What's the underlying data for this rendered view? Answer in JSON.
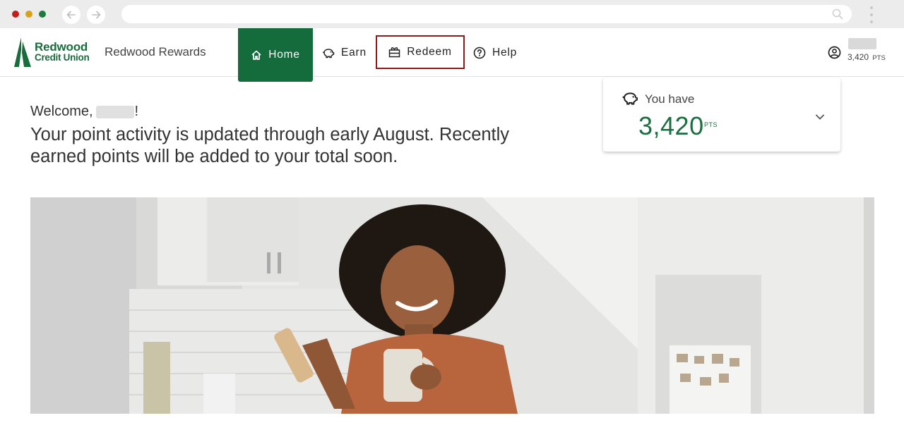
{
  "browser": {
    "back_icon": "arrow-left-icon",
    "forward_icon": "arrow-right-icon",
    "search_icon": "search-icon",
    "menu_icon": "kebab-menu-icon"
  },
  "brand": {
    "logo_line1": "Redwood",
    "logo_line2": "Credit Union",
    "program_name": "Redwood Rewards",
    "color": "#146b3c"
  },
  "nav": {
    "items": [
      {
        "label": "Home",
        "icon": "home-icon",
        "active": true
      },
      {
        "label": "Earn",
        "icon": "piggy-bank-icon"
      },
      {
        "label": "Redeem",
        "icon": "gift-icon",
        "highlighted": true
      },
      {
        "label": "Help",
        "icon": "help-circle-icon"
      }
    ]
  },
  "account": {
    "icon": "user-circle-icon",
    "points": "3,420",
    "points_unit": "PTS"
  },
  "welcome": {
    "greeting": "Welcome,",
    "suffix": "!",
    "message": "Your point activity is updated through early August. Recently earned points will be added to your total soon."
  },
  "points_card": {
    "label": "You have",
    "points": "3,420",
    "unit": "PTS",
    "icon": "piggy-bank-icon",
    "expand_icon": "chevron-down-icon"
  },
  "hero": {
    "description_icon": "hero-photo"
  }
}
